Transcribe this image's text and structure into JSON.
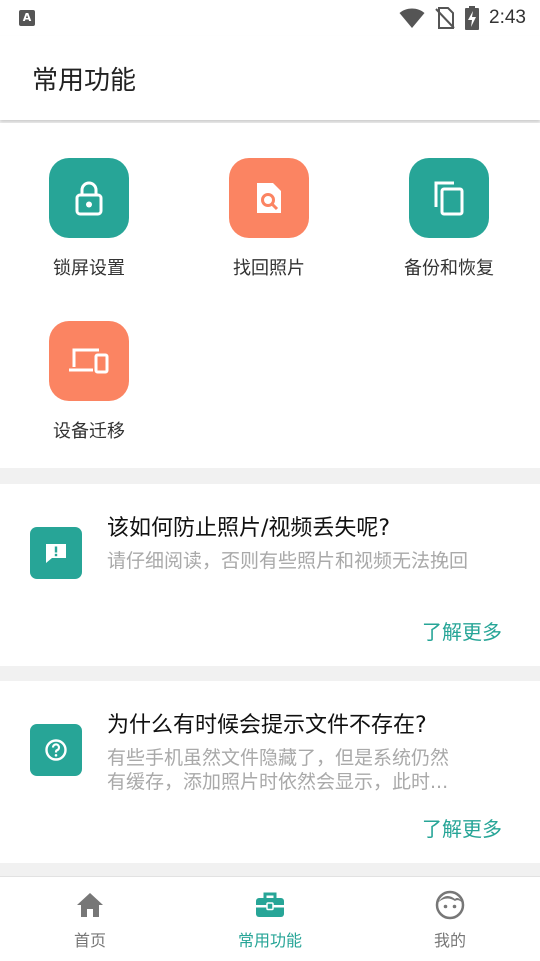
{
  "status_bar": {
    "time": "2:43",
    "notification_icon_letter": "A"
  },
  "app_bar": {
    "title": "常用功能"
  },
  "features": [
    {
      "label": "锁屏设置",
      "icon": "lock-icon",
      "color": "#27a597"
    },
    {
      "label": "找回照片",
      "icon": "photo-search-icon",
      "color": "#fb8462"
    },
    {
      "label": "备份和恢复",
      "icon": "copy-icon",
      "color": "#27a597"
    },
    {
      "label": "设备迁移",
      "icon": "devices-icon",
      "color": "#fb8462"
    }
  ],
  "cards": [
    {
      "icon": "alert-message-icon",
      "title": "该如何防止照片/视频丢失呢?",
      "desc": "请仔细阅读，否则有些照片和视频无法挽回",
      "more": "了解更多"
    },
    {
      "icon": "help-icon",
      "title": "为什么有时候会提示文件不存在?",
      "desc_line1": "有些手机虽然文件隐藏了，但是系统仍然",
      "desc_line2": "有缓存，添加照片时依然会显示，此时...",
      "more": "了解更多"
    }
  ],
  "bottom_nav": [
    {
      "label": "首页",
      "icon": "home-icon",
      "active": false
    },
    {
      "label": "常用功能",
      "icon": "toolbox-icon",
      "active": true
    },
    {
      "label": "我的",
      "icon": "profile-face-icon",
      "active": false
    }
  ],
  "colors": {
    "accent": "#27a597",
    "orange": "#fb8462",
    "inactive": "#777777"
  }
}
